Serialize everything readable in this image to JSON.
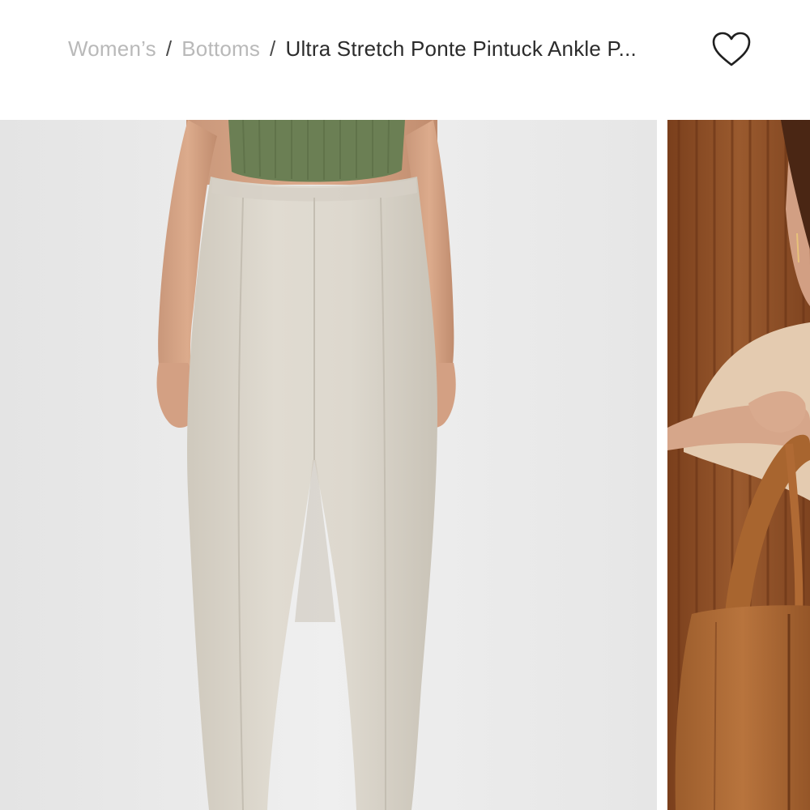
{
  "breadcrumb": {
    "items": [
      {
        "label": "Women’s"
      },
      {
        "label": "Bottoms"
      }
    ],
    "separator": "/",
    "current": "Ultra Stretch Ponte Pintuck Ankle P..."
  },
  "favorite": {
    "icon": "heart-outline-icon"
  },
  "gallery": {
    "images": [
      {
        "subject": "model-wearing-stone-ankle-pants",
        "product_color": "#dcd7cd",
        "top_color": "#6b7f54"
      },
      {
        "subject": "model-with-brown-leather-bag",
        "background_color": "#8a4a22"
      }
    ]
  },
  "colors": {
    "link_gray": "#b9b9b9",
    "text_dark": "#2b2b2b",
    "photo_bg": "#ececec"
  }
}
